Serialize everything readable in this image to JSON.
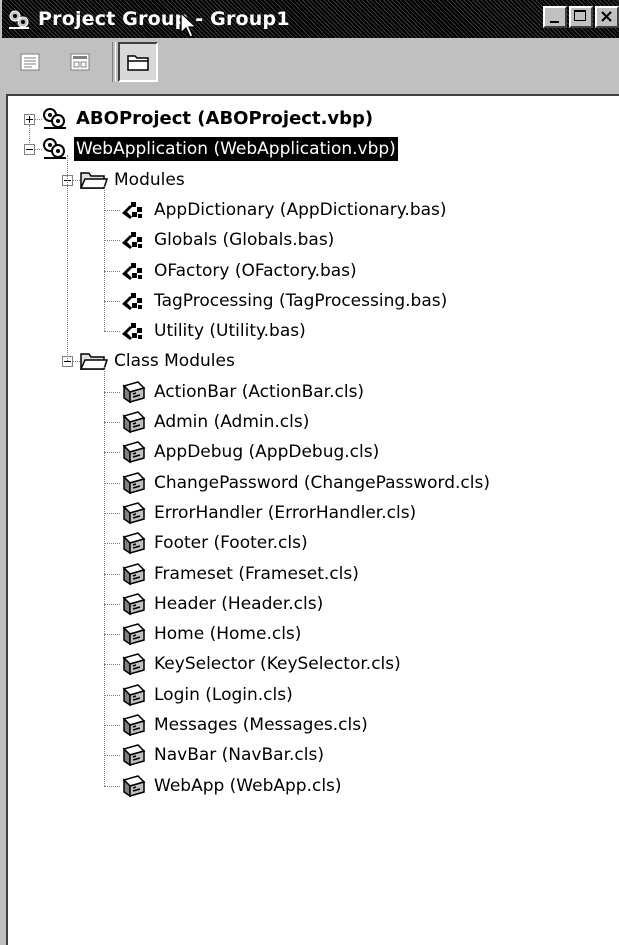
{
  "window": {
    "title": "Project Group - Group1",
    "minimize_glyph": "_",
    "maximize_glyph": "□",
    "close_glyph": "×"
  },
  "toolbar": {
    "buttons": [
      {
        "name": "view-code-button",
        "icon": "view-code-icon"
      },
      {
        "name": "view-object-button",
        "icon": "view-object-icon"
      },
      {
        "name": "toggle-folders-button",
        "icon": "folder-icon",
        "pressed": true
      }
    ]
  },
  "tree": {
    "projects": [
      {
        "label": "ABOProject (ABOProject.vbp)",
        "expanded": false,
        "bold": true
      },
      {
        "label": "WebApplication (WebApplication.vbp)",
        "expanded": true,
        "selected": true
      }
    ],
    "folders": [
      {
        "label": "Modules",
        "items": [
          "AppDictionary (AppDictionary.bas)",
          "Globals (Globals.bas)",
          "OFactory (OFactory.bas)",
          "TagProcessing (TagProcessing.bas)",
          "Utility (Utility.bas)"
        ]
      },
      {
        "label": "Class Modules",
        "items": [
          "ActionBar (ActionBar.cls)",
          "Admin (Admin.cls)",
          "AppDebug (AppDebug.cls)",
          "ChangePassword (ChangePassword.cls)",
          "ErrorHandler (ErrorHandler.cls)",
          "Footer (Footer.cls)",
          "Frameset (Frameset.cls)",
          "Header (Header.cls)",
          "Home (Home.cls)",
          "KeySelector (KeySelector.cls)",
          "Login (Login.cls)",
          "Messages (Messages.cls)",
          "NavBar (NavBar.cls)",
          "WebApp (WebApp.cls)"
        ]
      }
    ]
  }
}
